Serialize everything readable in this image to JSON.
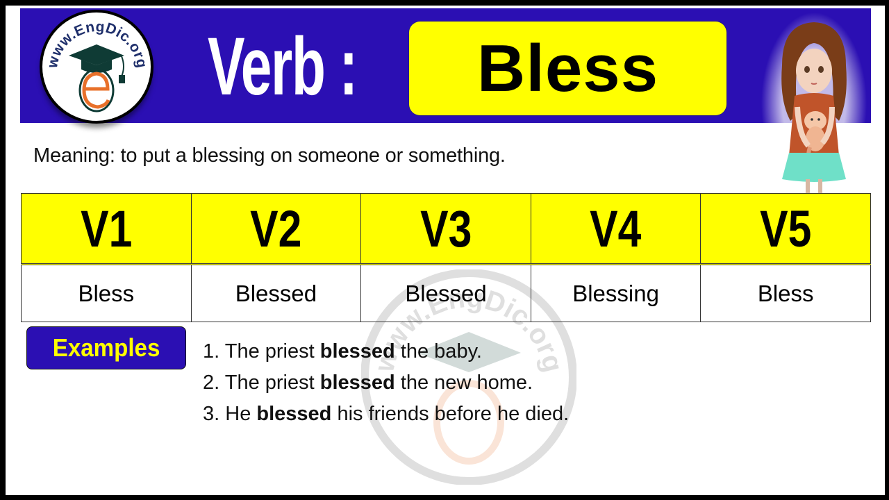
{
  "header": {
    "logo_text": "www.EngDic.org",
    "verb_label": "Verb :",
    "word": "Bless"
  },
  "meaning": "Meaning: to put a blessing on someone or something.",
  "forms_table": {
    "headers": [
      "V1",
      "V2",
      "V3",
      "V4",
      "V5"
    ],
    "values": [
      "Bless",
      "Blessed",
      "Blessed",
      "Blessing",
      "Bless"
    ]
  },
  "examples": {
    "badge_label": "Examples",
    "items": [
      {
        "number": "1.",
        "before": "The priest",
        "bold": "blessed",
        "after": "the baby."
      },
      {
        "number": "2.",
        "before": "The priest",
        "bold": "blessed",
        "after": "the new home."
      },
      {
        "number": "3.",
        "before": "He",
        "bold": "blessed",
        "after": "his friends before he died."
      }
    ]
  },
  "colors": {
    "header_blue": "#2b0fb3",
    "highlight_yellow": "#ffff00",
    "logo_orange": "#e8702a",
    "logo_navy": "#1f2f6b",
    "cap_green": "#0f3b35"
  },
  "icons": {
    "logo": "engdic-logo-icon",
    "girl": "girl-with-cat-illustration-icon",
    "watermark": "engdic-watermark-icon"
  }
}
